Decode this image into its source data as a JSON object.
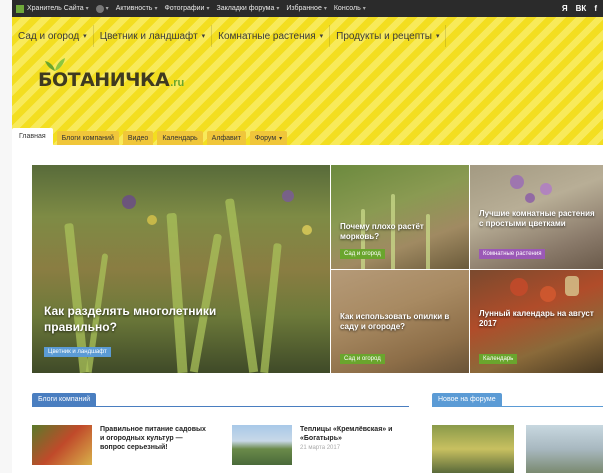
{
  "admin_bar": {
    "items": [
      {
        "label": "Хранитель Сайта"
      },
      {
        "label": ""
      },
      {
        "label": "Активность"
      },
      {
        "label": "Фотографии"
      },
      {
        "label": "Закладки форума"
      },
      {
        "label": "Избранное"
      },
      {
        "label": "Консоль"
      }
    ],
    "social": [
      "Я",
      "ВК",
      "f"
    ]
  },
  "top_nav": [
    {
      "label": "Сад и огород"
    },
    {
      "label": "Цветник и ландшафт"
    },
    {
      "label": "Комнатные растения"
    },
    {
      "label": "Продукты и рецепты"
    }
  ],
  "logo": {
    "name": "БОТАНИЧКА",
    "tld": ".ru"
  },
  "tabs": [
    {
      "label": "Главная",
      "active": true
    },
    {
      "label": "Блоги компаний"
    },
    {
      "label": "Видео"
    },
    {
      "label": "Календарь"
    },
    {
      "label": "Алфавит"
    },
    {
      "label": "Форум",
      "dropdown": true
    }
  ],
  "featured": {
    "main": {
      "title": "Как разделять многолетники правильно?",
      "category": "Цветник и ландшафт",
      "category_color": "#5b9bd5"
    },
    "tiles": [
      {
        "title": "Почему плохо растёт морковь?",
        "category": "Сад и огород",
        "category_color": "#6aa52d"
      },
      {
        "title": "Лучшие комнатные растения с простыми цветками",
        "category": "Комнатные растения",
        "category_color": "#9b59b6"
      },
      {
        "title": "Как использовать опилки в саду и огороде?",
        "category": "Сад и огород",
        "category_color": "#6aa52d"
      },
      {
        "title": "Лунный календарь на август 2017",
        "category": "Календарь",
        "category_color": "#6aa52d"
      }
    ]
  },
  "blogs": {
    "heading": "Блоги компаний",
    "posts": [
      {
        "title": "Правильное питание садовых и огородных культур — вопрос серьезный!",
        "date": ""
      },
      {
        "title": "Теплицы «Кремлёвская» и «Богатырь»",
        "date": "21 марта 2017"
      }
    ]
  },
  "forum": {
    "heading": "Новое на форуме"
  },
  "colors": {
    "accent_blue": "#4a7ec0",
    "header_yellow": "#f3de20",
    "tab_orange": "#f0c63a"
  }
}
